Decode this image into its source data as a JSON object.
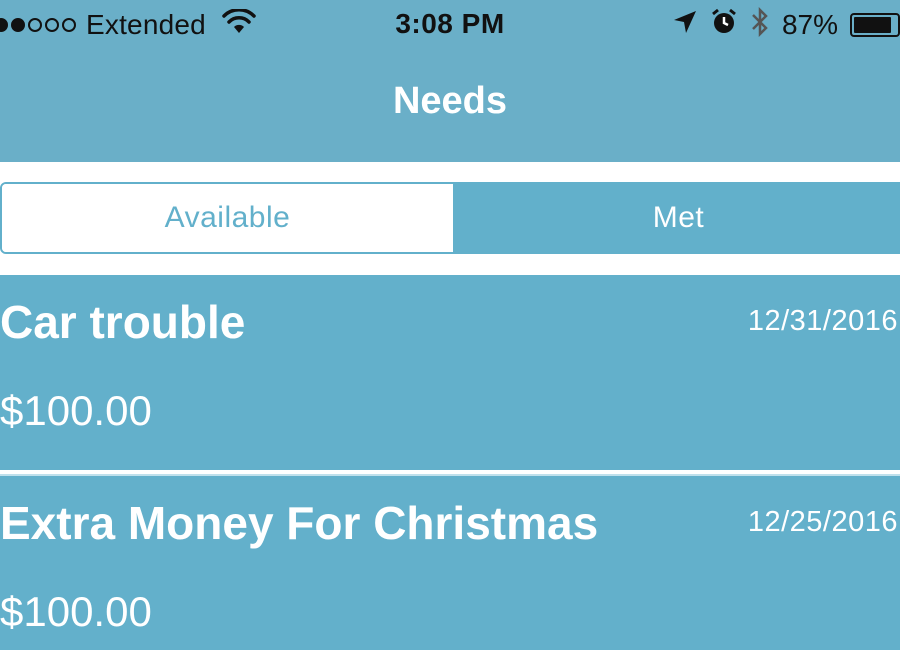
{
  "status_bar": {
    "carrier": "Extended",
    "time": "3:08 PM",
    "battery_percent": "87%",
    "battery_level": 0.87,
    "icons": [
      "signal-dots-icon",
      "wifi-icon",
      "location-arrow-icon",
      "alarm-icon",
      "bluetooth-icon",
      "battery-icon"
    ]
  },
  "nav": {
    "title": "Needs"
  },
  "segments": {
    "items": [
      {
        "label": "Available",
        "selected": false
      },
      {
        "label": "Met",
        "selected": true
      }
    ]
  },
  "needs": [
    {
      "title": "Car trouble",
      "date": "12/31/2016",
      "amount": "$100.00"
    },
    {
      "title": "Extra Money For Christmas",
      "date": "12/25/2016",
      "amount": "$100.00"
    }
  ],
  "colors": {
    "primary": "#63b0cb",
    "nav": "#6aafc8",
    "text_light": "#ffffff"
  }
}
